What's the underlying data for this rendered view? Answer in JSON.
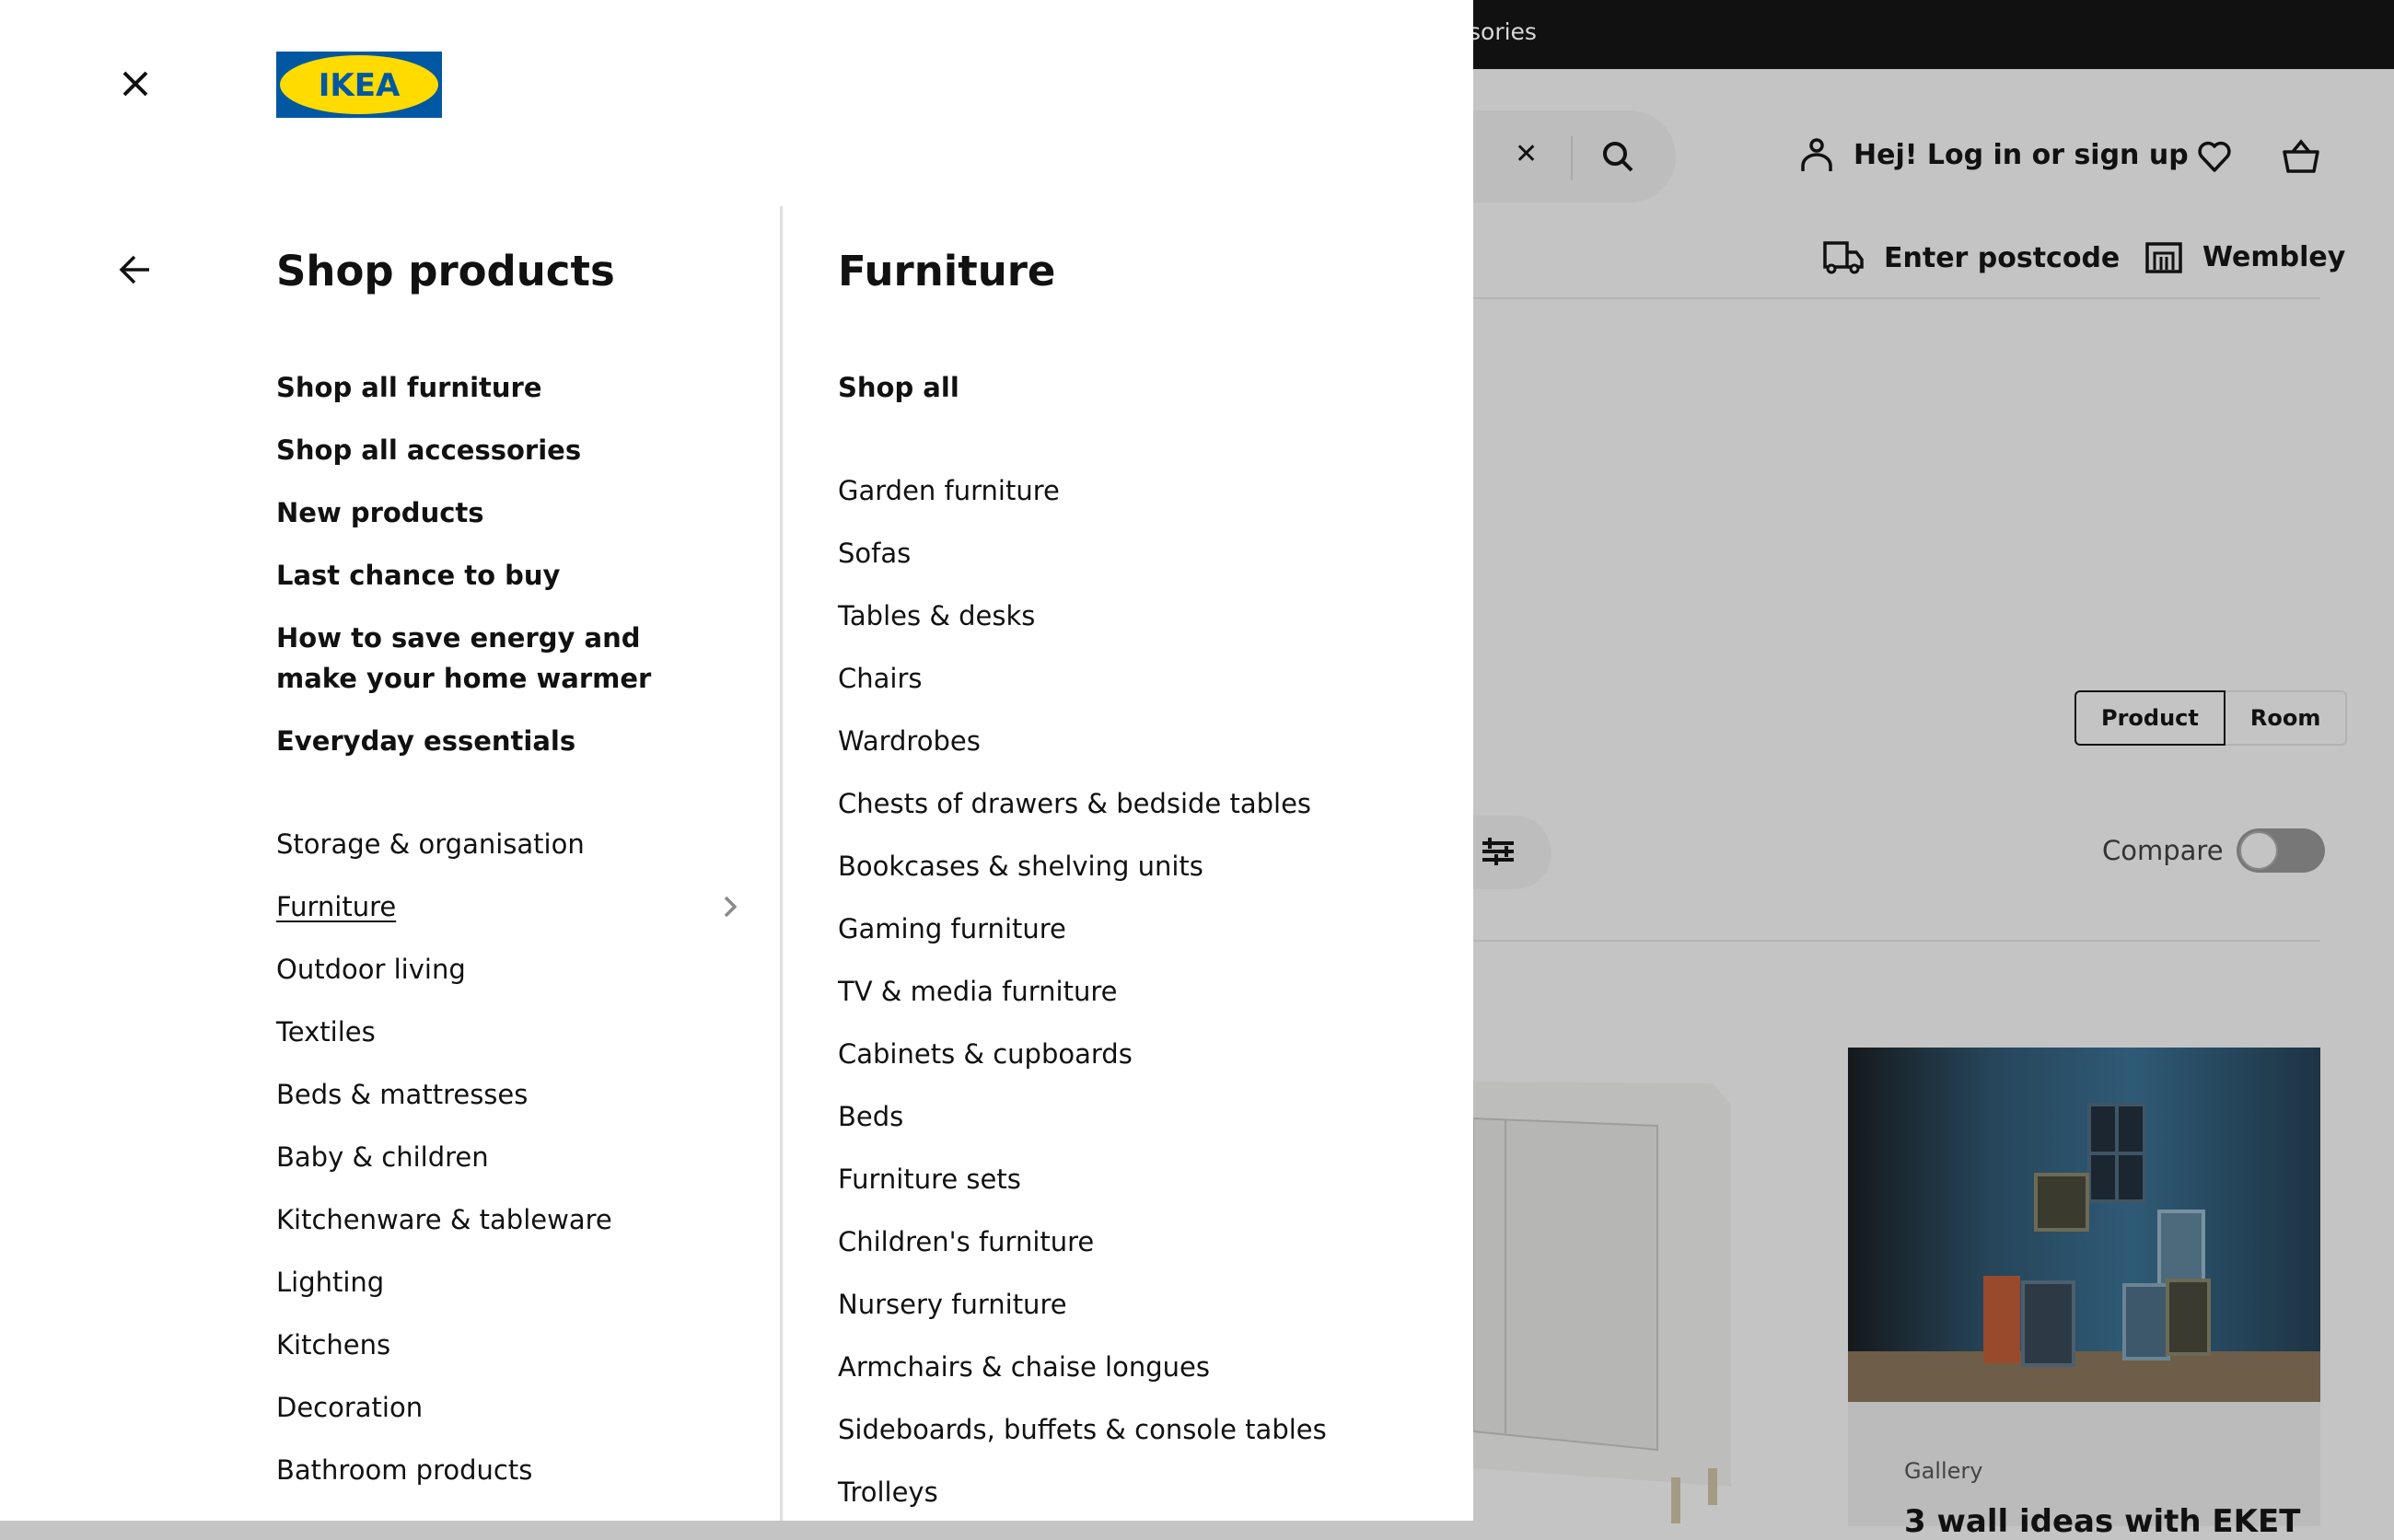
{
  "background_page": {
    "topbar_text": "sories",
    "search": {
      "clear_icon": "close-icon",
      "search_icon": "search-icon"
    },
    "login_label": "Hej! Log in or sign up",
    "icons": {
      "user": "user-icon",
      "wishlist": "heart-icon",
      "cart": "basket-icon"
    },
    "delivery_label": "Enter postcode",
    "store_label": "Wembley",
    "view_toggle": {
      "options": [
        "Product",
        "Room"
      ],
      "selected": "Product"
    },
    "compare_label": "Compare",
    "compare_on": false,
    "gallery_card": {
      "kicker": "Gallery",
      "title": "3 wall ideas with EKET"
    }
  },
  "menu": {
    "brand": "IKEA",
    "brand_colors": {
      "blue": "#0058a3",
      "yellow": "#ffdb00"
    },
    "left_column": {
      "heading": "Shop products",
      "featured_links": [
        "Shop all furniture",
        "Shop all accessories",
        "New products",
        "Last chance to buy",
        "How to save energy and make your home warmer",
        "Everyday essentials"
      ],
      "categories": [
        "Storage & organisation",
        "Furniture",
        "Outdoor living",
        "Textiles",
        "Beds & mattresses",
        "Baby & children",
        "Kitchenware & tableware",
        "Lighting",
        "Kitchens",
        "Decoration",
        "Bathroom products"
      ],
      "active_category": "Furniture"
    },
    "right_column": {
      "heading": "Furniture",
      "shop_all": "Shop all",
      "items": [
        "Garden furniture",
        "Sofas",
        "Tables & desks",
        "Chairs",
        "Wardrobes",
        "Chests of drawers & bedside tables",
        "Bookcases & shelving units",
        "Gaming furniture",
        "TV & media furniture",
        "Cabinets & cupboards",
        "Beds",
        "Furniture sets",
        "Children's furniture",
        "Nursery furniture",
        "Armchairs & chaise longues",
        "Sideboards, buffets & console tables",
        "Trolleys"
      ]
    }
  }
}
